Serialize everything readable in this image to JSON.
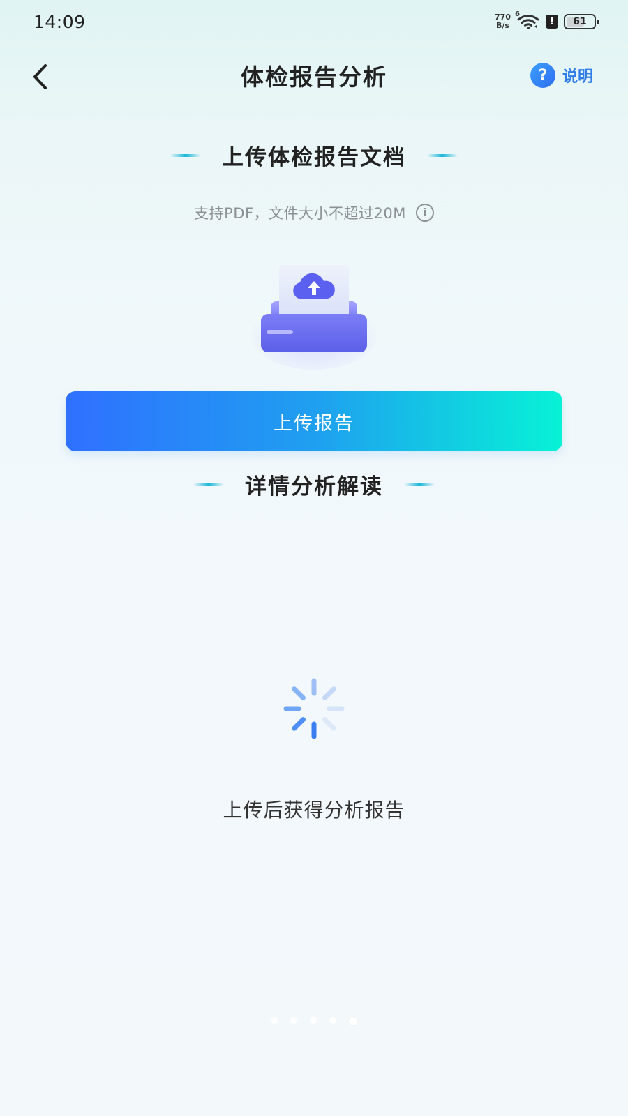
{
  "status_bar": {
    "time": "14:09",
    "net_speed_value": "770",
    "net_speed_unit": "B/s",
    "wifi_label": "6",
    "alert": "!",
    "battery": "61"
  },
  "header": {
    "title": "体检报告分析",
    "help_label": "说明",
    "help_icon": "?"
  },
  "upload_section": {
    "title": "上传体检报告文档",
    "hint": "支持PDF，文件大小不超过20M",
    "info_icon": "i",
    "button_label": "上传报告"
  },
  "detail_section": {
    "title": "详情分析解读",
    "loading_text": "上传后获得分析报告"
  },
  "colors": {
    "accent_start": "#2f70ff",
    "accent_end": "#07f2d6",
    "help_text": "#2f7ee8"
  },
  "icons": {
    "back": "chevron-left-icon",
    "help": "question-circle-icon",
    "info": "info-circle-icon",
    "upload": "cloud-upload-icon",
    "loading": "spinner-icon"
  }
}
